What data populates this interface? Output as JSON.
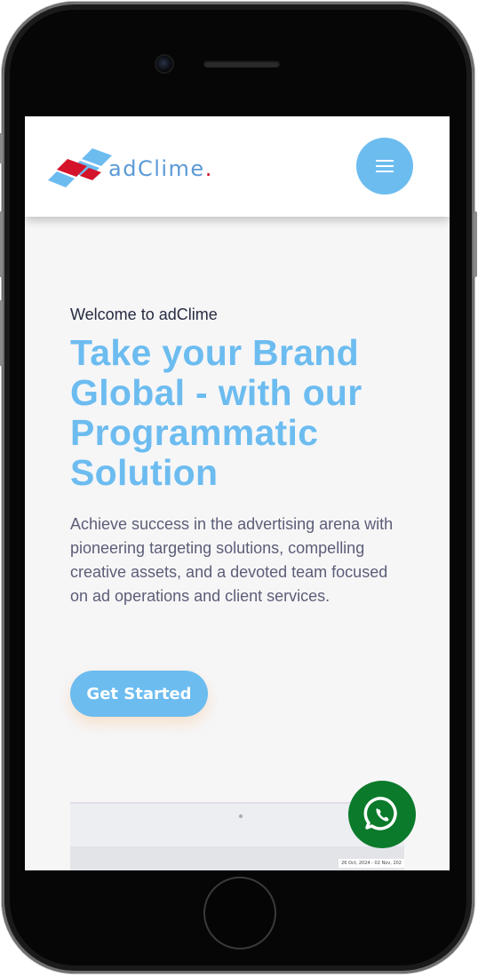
{
  "brand": {
    "name": "adClime",
    "dot": ".",
    "text_color": "#5b9ad6",
    "dot_color": "#d4122a",
    "mark_colors": [
      "#6cbcf0",
      "#d4122a"
    ]
  },
  "header": {
    "menu_icon": "hamburger-menu-icon",
    "menu_color": "#6cbcf0"
  },
  "hero": {
    "eyebrow": "Welcome to adClime",
    "title": "Take your Brand Global - with our Programmatic Solution",
    "description": "Achieve success in the advertising arena with pioneering targeting solutions, compelling creative assets, and a devoted team focused on ad operations and client services.",
    "cta_label": "Get Started",
    "accent_color": "#6cbcf0"
  },
  "preview": {
    "tag_text": "26 Oct, 2024 - 02 Nov, 202"
  },
  "floating": {
    "icon": "whatsapp-icon",
    "color": "#0b7a2b"
  }
}
